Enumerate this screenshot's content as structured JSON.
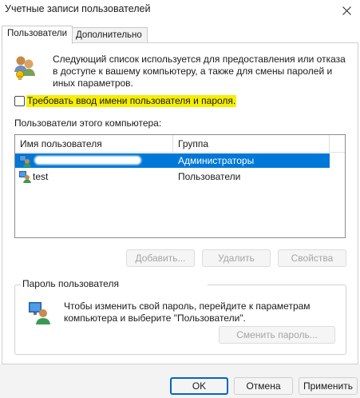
{
  "window": {
    "title": "Учетные записи пользователей"
  },
  "tabs": [
    {
      "label": "Пользователи"
    },
    {
      "label": "Дополнительно"
    }
  ],
  "intro_text": "Следующий список используется для предоставления или отказа в доступе к вашему компьютеру, а также для смены паролей и иных параметров.",
  "require_login_checkbox": {
    "label": "Требовать ввод имени пользователя и пароля.",
    "checked": false
  },
  "users_section_label": "Пользователи этого компьютера:",
  "users_table": {
    "columns": [
      "Имя пользователя",
      "Группа"
    ],
    "rows": [
      {
        "name": "",
        "group": "Администраторы",
        "selected": true
      },
      {
        "name": "test",
        "group": "Пользователи",
        "selected": false
      }
    ]
  },
  "user_buttons": {
    "add": "Добавить...",
    "remove": "Удалить",
    "properties": "Свойства"
  },
  "password_group": {
    "label": "Пароль пользователя",
    "text": "Чтобы изменить свой пароль, перейдите к параметрам компьютера и выберите \"Пользователи\".",
    "button": "Сменить пароль..."
  },
  "footer_buttons": {
    "ok": "OK",
    "cancel": "Отмена",
    "apply": "Применить"
  },
  "colors": {
    "selection": "#0078d7",
    "highlight": "#f5ee00",
    "primary_border": "#0067c0"
  },
  "icons": {
    "window_close": "close-icon",
    "users": "users-group-icon",
    "user_row": "user-account-icon",
    "password": "user-password-icon"
  }
}
